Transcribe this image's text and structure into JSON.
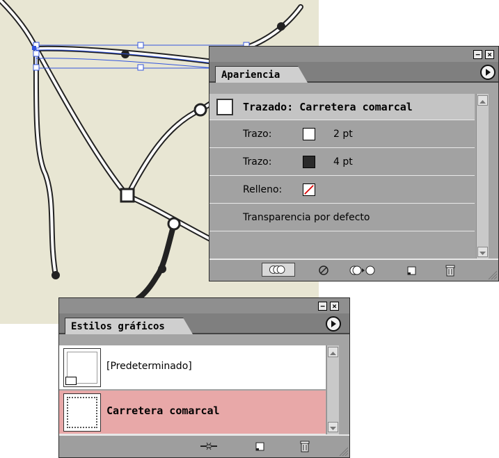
{
  "appearance_panel": {
    "tab_label": "Apariencia",
    "header_label": "Trazado: Carretera comarcal",
    "rows": [
      {
        "label": "Trazo:",
        "value": "2 pt"
      },
      {
        "label": "Trazo:",
        "value": "4 pt"
      },
      {
        "label": "Relleno:"
      },
      {
        "label": "Transparencia por defecto"
      }
    ],
    "toolbar_icons": [
      "new-art-basic-appearance-icon",
      "clear-appearance-icon",
      "reduce-to-basic-icon",
      "duplicate-item-icon",
      "delete-item-icon"
    ]
  },
  "styles_panel": {
    "tab_label": "Estilos gráficos",
    "items": [
      {
        "label": "[Predeterminado]"
      },
      {
        "label": "Carretera comarcal"
      }
    ],
    "selected_bg": "#e8a8a8",
    "toolbar_icons": [
      "break-link-icon",
      "new-style-icon",
      "delete-style-icon"
    ]
  },
  "colors": {
    "artboard": "#e8e6d3",
    "selection": "#3355dd"
  }
}
